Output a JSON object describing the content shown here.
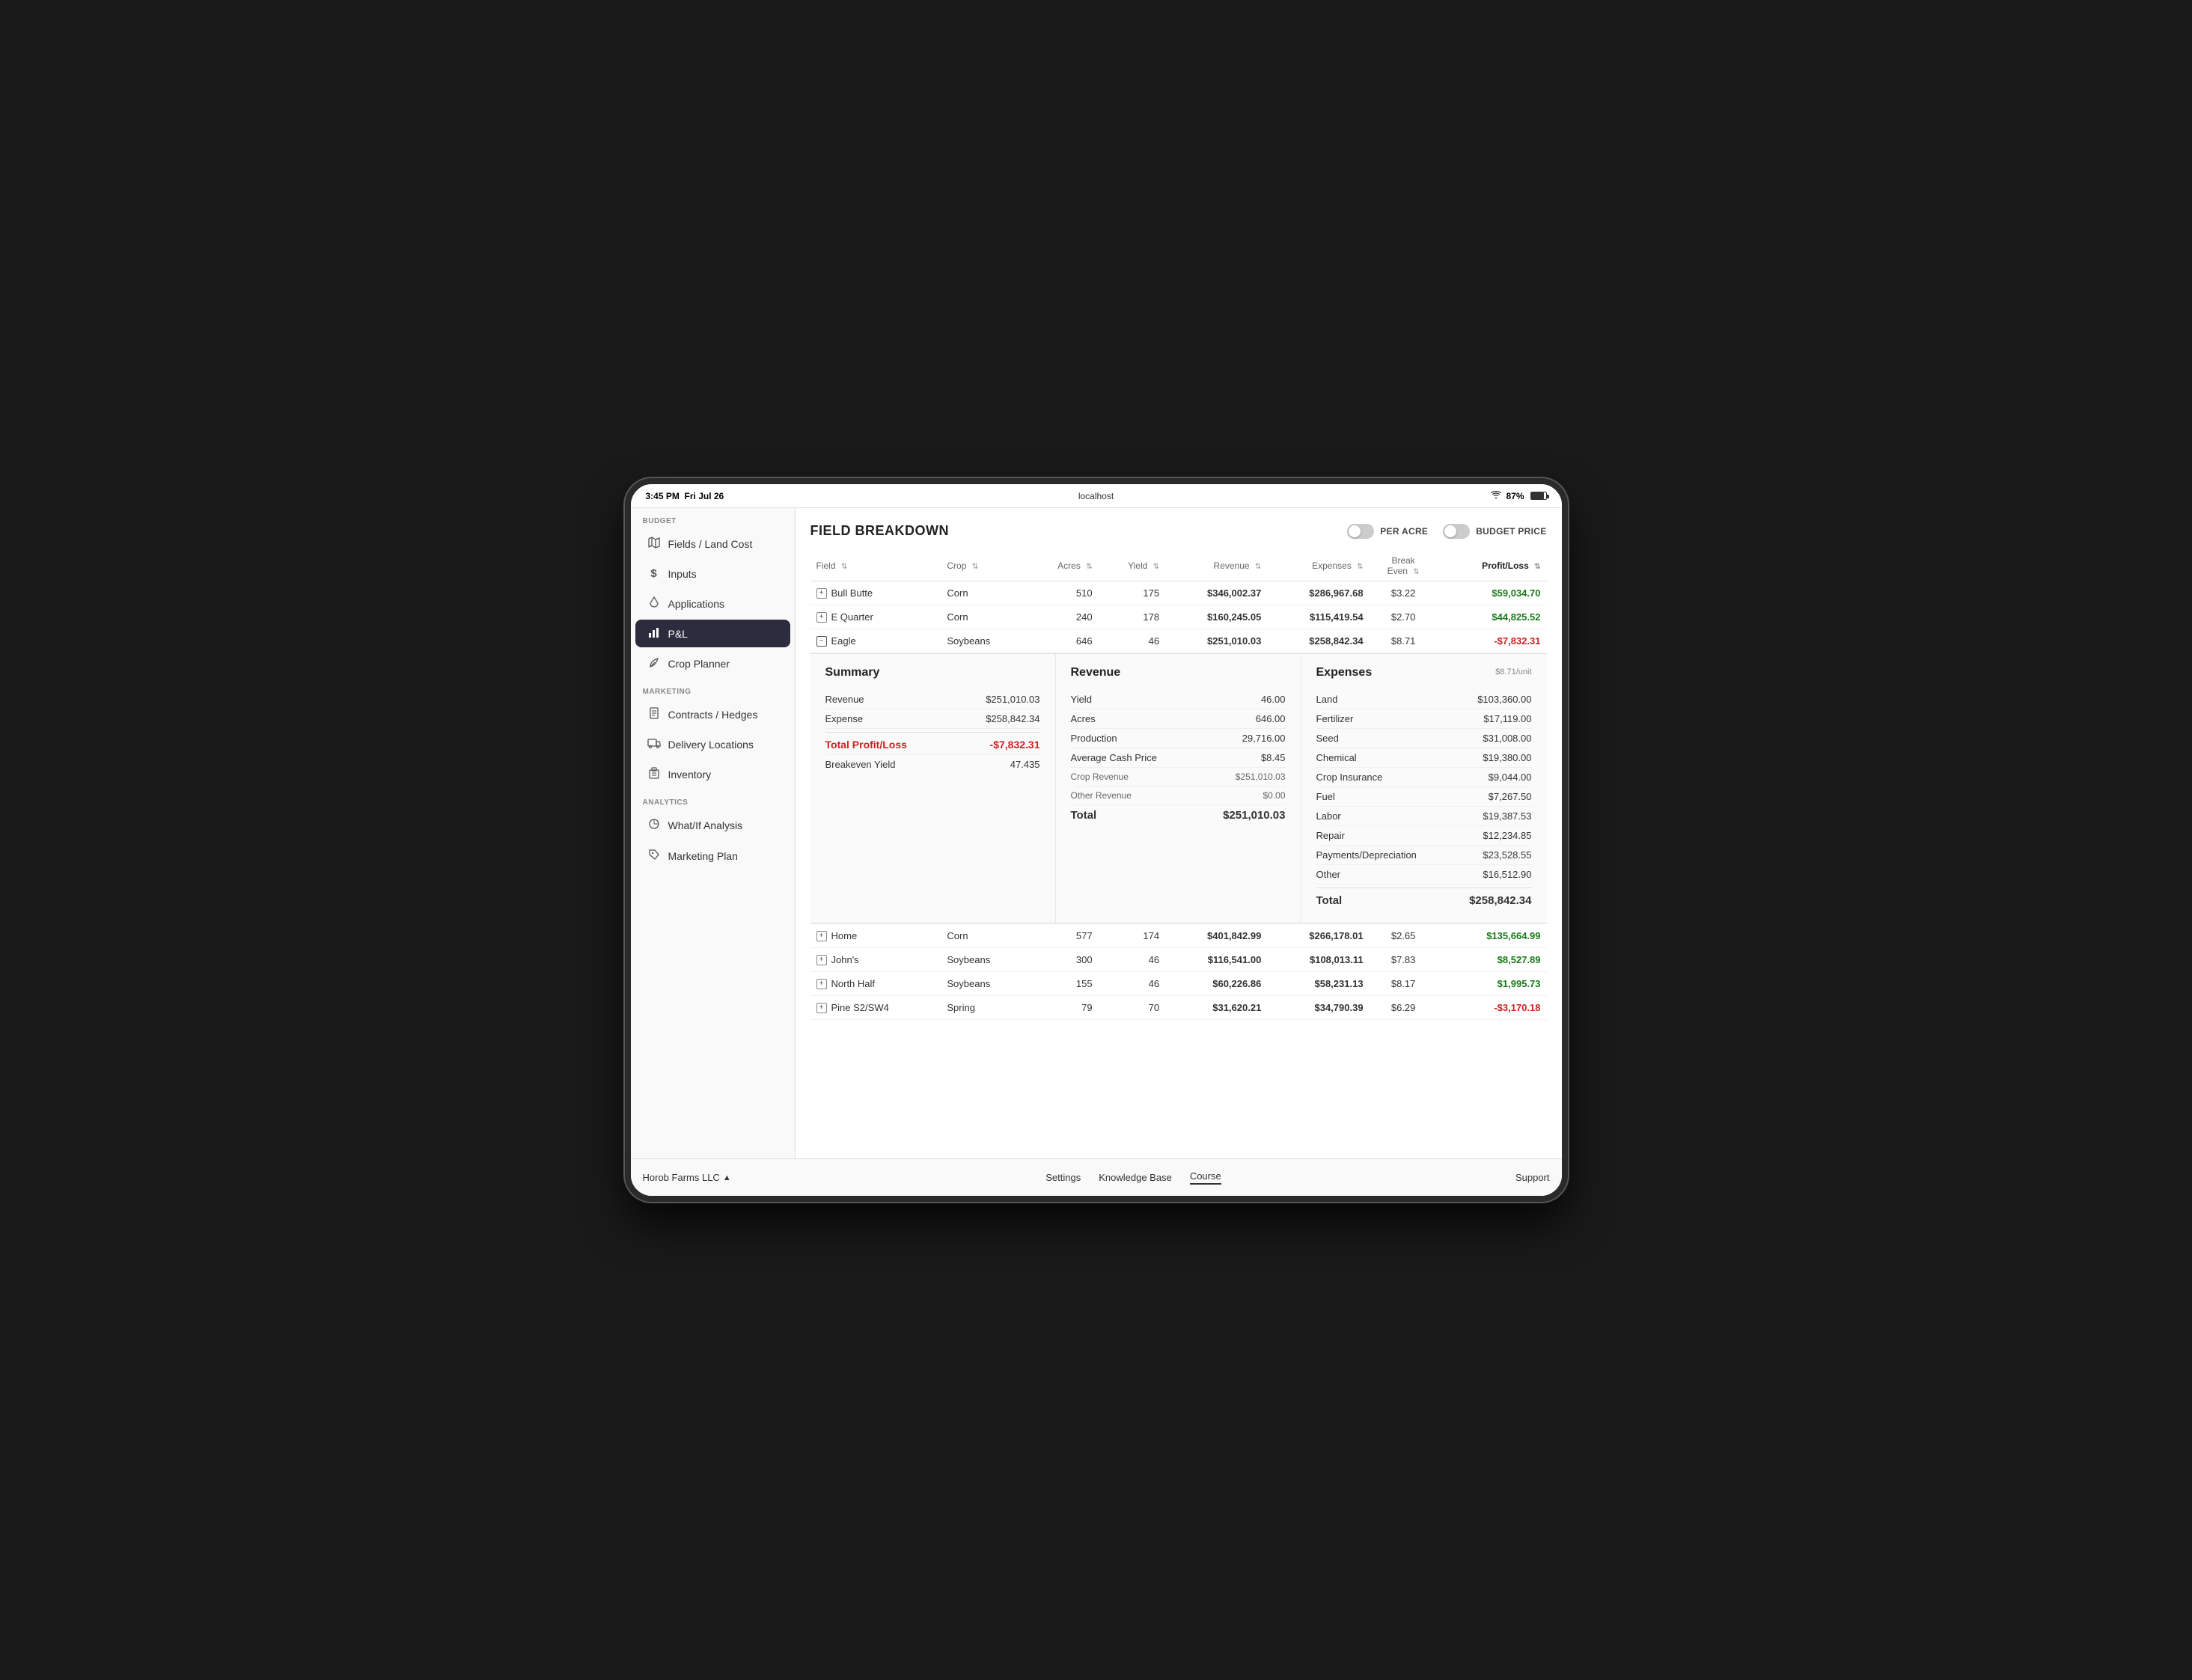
{
  "device": {
    "time": "3:45 PM",
    "date": "Fri Jul 26",
    "url": "localhost",
    "wifi": "wifi",
    "battery": "87%"
  },
  "sidebar": {
    "budget_label": "BUDGET",
    "items_budget": [
      {
        "id": "fields-land-cost",
        "icon": "🗺",
        "label": "Fields / Land Cost",
        "active": false
      },
      {
        "id": "inputs",
        "icon": "$",
        "label": "Inputs",
        "active": false
      },
      {
        "id": "applications",
        "icon": "💧",
        "label": "Applications",
        "active": false
      },
      {
        "id": "pl",
        "icon": "📊",
        "label": "P&L",
        "active": true
      },
      {
        "id": "crop-planner",
        "icon": "🌿",
        "label": "Crop Planner",
        "active": false
      }
    ],
    "marketing_label": "MARKETING",
    "items_marketing": [
      {
        "id": "contracts-hedges",
        "icon": "📄",
        "label": "Contracts / Hedges",
        "active": false
      },
      {
        "id": "delivery-locations",
        "icon": "🚚",
        "label": "Delivery Locations",
        "active": false
      },
      {
        "id": "inventory",
        "icon": "📦",
        "label": "Inventory",
        "active": false
      }
    ],
    "analytics_label": "ANALYTICS",
    "items_analytics": [
      {
        "id": "what-if-analysis",
        "icon": "📈",
        "label": "What/If Analysis",
        "active": false
      },
      {
        "id": "marketing-plan",
        "icon": "🏷",
        "label": "Marketing Plan",
        "active": false
      }
    ]
  },
  "page": {
    "title": "FIELD BREAKDOWN",
    "toggle_per_acre_label": "PER ACRE",
    "toggle_budget_price_label": "BUDGET PRICE",
    "toggle_per_acre_on": false,
    "toggle_budget_price_on": false
  },
  "table": {
    "headers": {
      "field": "Field",
      "crop": "Crop",
      "acres": "Acres",
      "yield": "Yield",
      "revenue": "Revenue",
      "expenses": "Expenses",
      "break_even": "Break Even",
      "profit_loss": "Profit/Loss"
    },
    "rows": [
      {
        "plus": true,
        "name": "Bull Butte",
        "crop": "Corn",
        "acres": "510",
        "yield": "175",
        "revenue": "$346,002.37",
        "expenses": "$286,967.68",
        "break_even": "$3.22",
        "profit_loss": "$59,034.70",
        "profit_positive": true,
        "expanded": false
      },
      {
        "plus": true,
        "name": "E Quarter",
        "crop": "Corn",
        "acres": "240",
        "yield": "178",
        "revenue": "$160,245.05",
        "expenses": "$115,419.54",
        "break_even": "$2.70",
        "profit_loss": "$44,825.52",
        "profit_positive": true,
        "expanded": false
      },
      {
        "plus": false,
        "minus": true,
        "name": "Eagle",
        "crop": "Soybeans",
        "acres": "646",
        "yield": "46",
        "revenue": "$251,010.03",
        "expenses": "$258,842.34",
        "break_even": "$8.71",
        "profit_loss": "-$7,832.31",
        "profit_positive": false,
        "expanded": true
      },
      {
        "plus": true,
        "name": "Home",
        "crop": "Corn",
        "acres": "577",
        "yield": "174",
        "revenue": "$401,842.99",
        "expenses": "$266,178.01",
        "break_even": "$2.65",
        "profit_loss": "$135,664.99",
        "profit_positive": true,
        "expanded": false
      },
      {
        "plus": true,
        "name": "John's",
        "crop": "Soybeans",
        "acres": "300",
        "yield": "46",
        "revenue": "$116,541.00",
        "expenses": "$108,013.11",
        "break_even": "$7.83",
        "profit_loss": "$8,527.89",
        "profit_positive": true,
        "expanded": false
      },
      {
        "plus": true,
        "name": "North Half",
        "crop": "Soybeans",
        "acres": "155",
        "yield": "46",
        "revenue": "$60,226.86",
        "expenses": "$58,231.13",
        "break_even": "$8.17",
        "profit_loss": "$1,995.73",
        "profit_positive": true,
        "expanded": false
      },
      {
        "plus": true,
        "name": "Pine S2/SW4",
        "crop": "Spring",
        "acres": "79",
        "yield": "70",
        "revenue": "$31,620.21",
        "expenses": "$34,790.39",
        "break_even": "$6.29",
        "profit_loss": "-$3,170.18",
        "profit_positive": false,
        "expanded": false
      }
    ]
  },
  "expanded": {
    "summary": {
      "title": "Summary",
      "revenue_label": "Revenue",
      "revenue_value": "$251,010.03",
      "expense_label": "Expense",
      "expense_value": "$258,842.34",
      "total_pl_label": "Total Profit/Loss",
      "total_pl_value": "-$7,832.31",
      "breakeven_yield_label": "Breakeven Yield",
      "breakeven_yield_value": "47.435"
    },
    "revenue": {
      "title": "Revenue",
      "yield_label": "Yield",
      "yield_value": "46.00",
      "acres_label": "Acres",
      "acres_value": "646.00",
      "production_label": "Production",
      "production_value": "29,716.00",
      "avg_cash_price_label": "Average Cash Price",
      "avg_cash_price_value": "$8.45",
      "crop_revenue_label": "Crop Revenue",
      "crop_revenue_value": "$251,010.03",
      "other_revenue_label": "Other Revenue",
      "other_revenue_value": "$0.00",
      "total_label": "Total",
      "total_value": "$251,010.03"
    },
    "expenses": {
      "title": "Expenses",
      "unit_label": "$8.71/unit",
      "land_label": "Land",
      "land_value": "$103,360.00",
      "fertilizer_label": "Fertilizer",
      "fertilizer_value": "$17,119.00",
      "seed_label": "Seed",
      "seed_value": "$31,008.00",
      "chemical_label": "Chemical",
      "chemical_value": "$19,380.00",
      "crop_insurance_label": "Crop Insurance",
      "crop_insurance_value": "$9,044.00",
      "fuel_label": "Fuel",
      "fuel_value": "$7,267.50",
      "labor_label": "Labor",
      "labor_value": "$19,387.53",
      "repair_label": "Repair",
      "repair_value": "$12,234.85",
      "payments_depreciation_label": "Payments/Depreciation",
      "payments_depreciation_value": "$23,528.55",
      "other_label": "Other",
      "other_value": "$16,512.90",
      "total_label": "Total",
      "total_value": "$258,842.34"
    }
  },
  "bottom_bar": {
    "farm_name": "Horob Farms LLC",
    "settings_label": "Settings",
    "knowledge_base_label": "Knowledge Base",
    "course_label": "Course",
    "support_label": "Support"
  }
}
